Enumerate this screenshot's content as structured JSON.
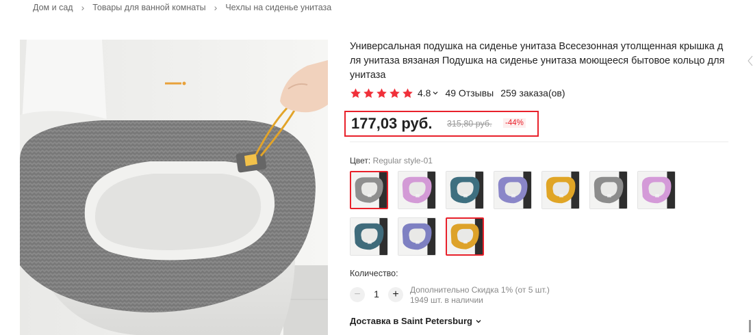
{
  "breadcrumb": {
    "items": [
      "Дом и сад",
      "Товары для ванной комнаты",
      "Чехлы на сиденье унитаза"
    ]
  },
  "product": {
    "title": "Универсальная подушка на сиденье унитаза Всесезонная утолщенная крышка для унитаза вязаная Подушка на сиденье унитаза моющееся бытовое кольцо для унитаза",
    "rating": "4.8",
    "stars": 5,
    "reviews": "49 Отзывы",
    "orders": "259 заказа(ов)"
  },
  "price": {
    "current": "177,03 руб.",
    "old": "315,80 руб.",
    "discount": "-44%"
  },
  "color": {
    "label": "Цвет:",
    "selected": "Regular style-01",
    "options": [
      {
        "name": "gray-1",
        "color": "#8f8f8f"
      },
      {
        "name": "pink-1",
        "color": "#d39ad6"
      },
      {
        "name": "teal-1",
        "color": "#3e6f80"
      },
      {
        "name": "purple-1",
        "color": "#8a86c8"
      },
      {
        "name": "yellow-1",
        "color": "#e0a526"
      },
      {
        "name": "gray-2",
        "color": "#8c8c8c"
      },
      {
        "name": "pink-2",
        "color": "#d49ad8"
      },
      {
        "name": "teal-2",
        "color": "#3f6b7b"
      },
      {
        "name": "purple-2",
        "color": "#7e80c2"
      },
      {
        "name": "yellow-2",
        "color": "#dda22a"
      }
    ]
  },
  "quantity": {
    "label": "Количество:",
    "value": "1",
    "minus": "−",
    "plus": "+",
    "bulk_discount": "Дополнительно Скидка 1% (от 5 шт.)",
    "stock": "1949 шт. в наличии"
  },
  "delivery": {
    "label": "Доставка в Saint Petersburg"
  },
  "colors": {
    "accent": "#e8202a",
    "star": "#f0303a"
  }
}
